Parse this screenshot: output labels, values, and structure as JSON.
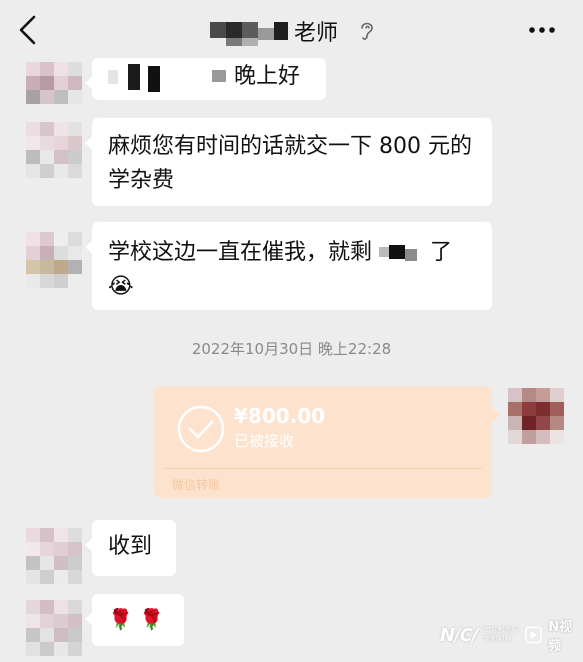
{
  "header": {
    "title": "老师"
  },
  "messages": [
    {
      "text": "晚上好"
    },
    {
      "text": "麻烦您有时间的话就交一下 800 元的学杂费"
    },
    {
      "text": "学校这边一直在催我，就剩",
      "suffix": "了",
      "emoji": "😭"
    },
    {
      "text": "收到"
    },
    {
      "text": "🌹 🌹"
    }
  ],
  "timestamp": "2022年10月30日 晚上22:28",
  "transfer": {
    "amount": "¥800.00",
    "status": "已被接收",
    "kind": "微信转账"
  },
  "watermark": {
    "ncw": "N/C/",
    "sub": "南方都市报 南都视频",
    "app": "N视频"
  },
  "colors": {
    "background": "#ededed",
    "bubble": "#ffffff",
    "transfer": "#fde3cd"
  },
  "icons": [
    "back-icon",
    "ear-icon",
    "more-icon",
    "check-icon",
    "crying-emoji",
    "rose-emoji"
  ]
}
